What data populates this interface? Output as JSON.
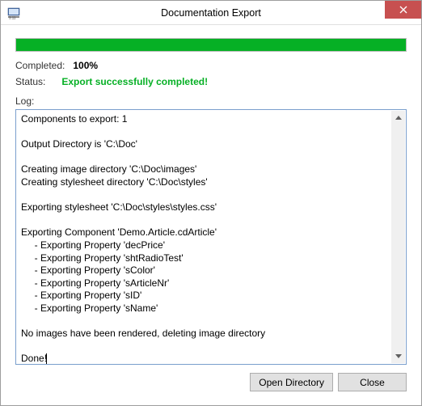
{
  "window": {
    "title": "Documentation Export",
    "icon_label": "app-icon"
  },
  "progress": {
    "percent": 100
  },
  "info": {
    "completed_label": "Completed:",
    "completed_value": "100%",
    "status_label": "Status:",
    "status_value": "Export successfully completed!"
  },
  "log": {
    "label": "Log:",
    "content": "Components to export: 1\n\nOutput Directory is 'C:\\Doc'\n\nCreating image directory 'C:\\Doc\\images'\nCreating stylesheet directory 'C:\\Doc\\styles'\n\nExporting stylesheet 'C:\\Doc\\styles\\styles.css'\n\nExporting Component 'Demo.Article.cdArticle'\n     - Exporting Property 'decPrice'\n     - Exporting Property 'shtRadioTest'\n     - Exporting Property 'sColor'\n     - Exporting Property 'sArticleNr'\n     - Exporting Property 'sID'\n     - Exporting Property 'sName'\n\nNo images have been rendered, deleting image directory\n\nDone!"
  },
  "buttons": {
    "open_directory": "Open Directory",
    "close": "Close"
  }
}
